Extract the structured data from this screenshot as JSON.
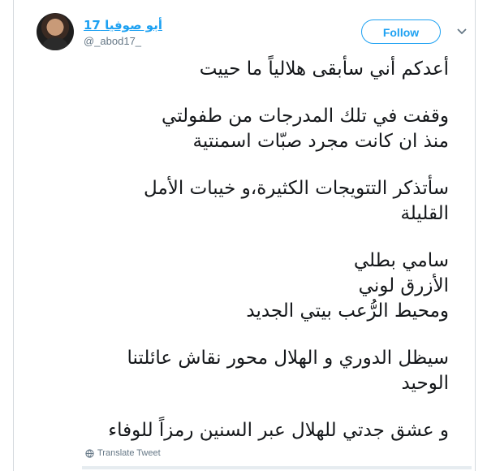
{
  "author": {
    "display_name": "أبو صوفيا 17",
    "handle": "@_abod17_"
  },
  "follow_label": "Follow",
  "tweet": {
    "paragraphs": [
      [
        "أعدكم أني سأبقى هلالياً ما حييت"
      ],
      [
        "وقفت في تلك المدرجات من طفولتي",
        "منذ ان كانت مجرد صبّات اسمنتية"
      ],
      [
        "سأتذكر التتويجات الكثيرة،و خيبات الأمل",
        "القليلة"
      ],
      [
        "سامي بطلي",
        "الأزرق لوني",
        "ومحيط الرُّعب بيتي الجديد"
      ],
      [
        "سيظل الدوري و الهلال محور نقاش عائلتنا",
        "الوحيد"
      ],
      [
        "و عشق جدتي للهلال عبر السنين رمزاً للوفاء"
      ]
    ]
  },
  "translate_label": "Translate Tweet",
  "colors": {
    "accent": "#1da1f2",
    "text": "#14171a",
    "secondary": "#657786"
  },
  "icons": {
    "chevron": "chevron-down-icon",
    "globe": "globe-icon"
  }
}
